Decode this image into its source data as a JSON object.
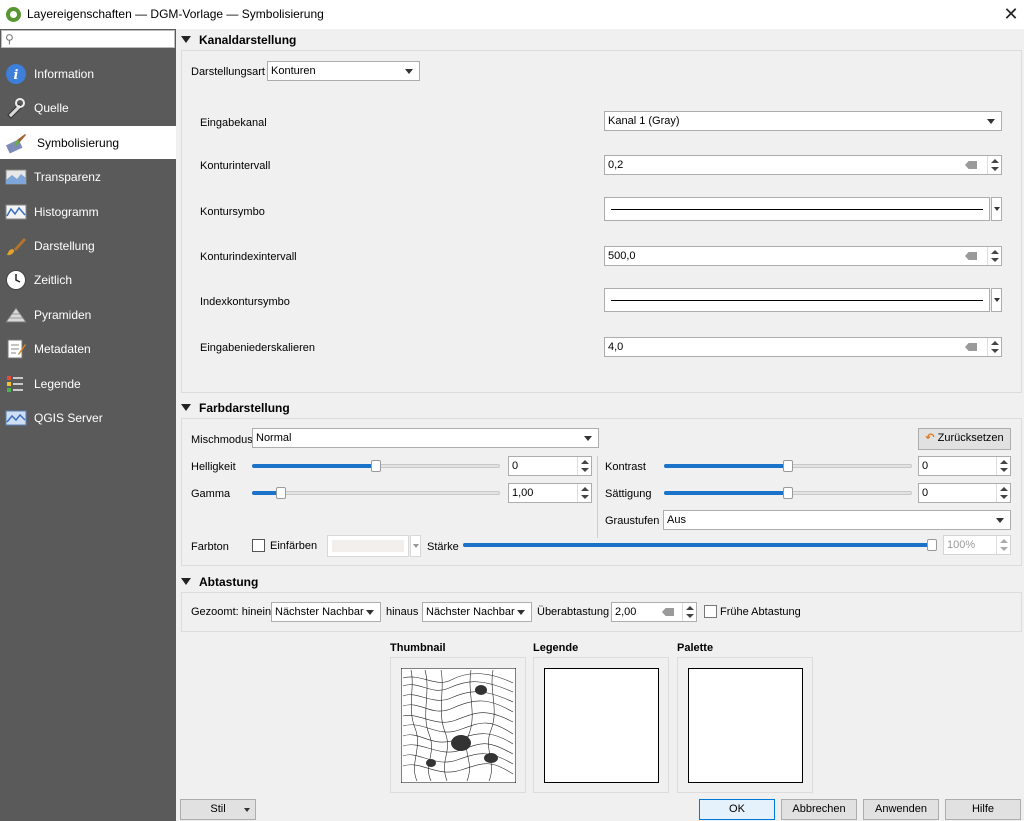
{
  "window": {
    "title": "Layereigenschaften — DGM-Vorlage — Symbolisierung"
  },
  "sidebar": {
    "search_placeholder": "",
    "items": [
      {
        "label": "Information",
        "icon": "info-icon"
      },
      {
        "label": "Quelle",
        "icon": "source-icon"
      },
      {
        "label": "Symbolisierung",
        "icon": "paintbrush-icon",
        "active": true
      },
      {
        "label": "Transparenz",
        "icon": "transparency-icon"
      },
      {
        "label": "Histogramm",
        "icon": "histogram-icon"
      },
      {
        "label": "Darstellung",
        "icon": "rendering-brush-icon"
      },
      {
        "label": "Zeitlich",
        "icon": "clock-icon"
      },
      {
        "label": "Pyramiden",
        "icon": "pyramid-icon"
      },
      {
        "label": "Metadaten",
        "icon": "metadata-icon"
      },
      {
        "label": "Legende",
        "icon": "legend-icon"
      },
      {
        "label": "QGIS Server",
        "icon": "server-icon"
      }
    ]
  },
  "kanal": {
    "header": "Kanaldarstellung",
    "render_type_label": "Darstellungsart",
    "render_type_value": "Konturen",
    "rows": {
      "input_band_label": "Eingabekanal",
      "input_band_value": "Kanal 1 (Gray)",
      "contour_interval_label": "Konturintervall",
      "contour_interval_value": "0,2",
      "contour_symbol_label": "Kontursymbo",
      "index_interval_label": "Konturindexintervall",
      "index_interval_value": "500,0",
      "index_symbol_label": "Indexkontursymbo",
      "downscale_label": "Eingabeniederskalieren",
      "downscale_value": "4,0"
    }
  },
  "farb": {
    "header": "Farbdarstellung",
    "blend_label": "Mischmodus",
    "blend_value": "Normal",
    "reset_label": "Zurücksetzen",
    "brightness_label": "Helligkeit",
    "brightness_value": "0",
    "brightness_level": 0.5,
    "contrast_label": "Kontrast",
    "contrast_value": "0",
    "contrast_level": 0.5,
    "gamma_label": "Gamma",
    "gamma_value": "1,00",
    "gamma_level": 0.1,
    "saturation_label": "Sättigung",
    "saturation_value": "0",
    "saturation_level": 0.5,
    "grayscale_label": "Graustufen",
    "grayscale_value": "Aus",
    "hue_label": "Farbton",
    "colorize_label": "Einfärben",
    "colorize_checked": false,
    "strength_label": "Stärke",
    "strength_value": "100%",
    "strength_level": 1.0
  },
  "abtastung": {
    "header": "Abtastung",
    "zoomed_in_label": "Gezoomt: hinein",
    "zoomed_in_value": "Nächster Nachbar",
    "zoomed_out_label": "hinaus",
    "zoomed_out_value": "Nächster Nachbar",
    "oversampling_label": "Überabtastung",
    "oversampling_value": "2,00",
    "early_label": "Frühe Abtastung",
    "early_checked": false
  },
  "previews": {
    "thumbnail_label": "Thumbnail",
    "legend_label": "Legende",
    "palette_label": "Palette"
  },
  "footer": {
    "style_label": "Stil",
    "ok_label": "OK",
    "cancel_label": "Abbrechen",
    "apply_label": "Anwenden",
    "help_label": "Hilfe"
  }
}
